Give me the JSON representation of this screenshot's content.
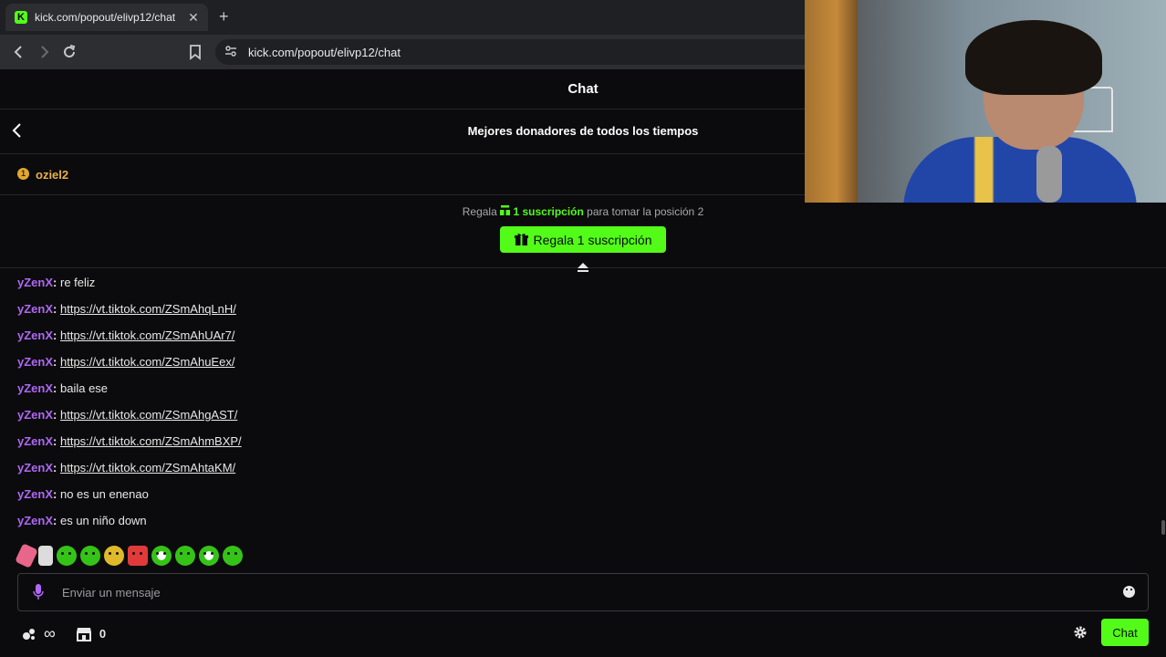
{
  "browser": {
    "tab_title": "kick.com/popout/elivp12/chat",
    "favicon_letter": "K",
    "tab_close": "✕",
    "new_tab": "+",
    "url": "kick.com/popout/elivp12/chat"
  },
  "chat": {
    "header_title": "Chat",
    "donors_title": "Mejores donadores de todos los tiempos",
    "top_donor": {
      "rank": "1",
      "name": "oziel2"
    },
    "gift_prompt": {
      "prefix": "Regala",
      "highlight": "1 suscripción",
      "suffix": "para tomar la posición 2"
    },
    "gift_button_label": "Regala 1 suscripción",
    "messages": [
      {
        "user": "yZenX",
        "text": "re feliz",
        "is_link": false
      },
      {
        "user": "yZenX",
        "text": "https://vt.tiktok.com/ZSmAhqLnH/",
        "is_link": true
      },
      {
        "user": "yZenX",
        "text": "https://vt.tiktok.com/ZSmAhUAr7/",
        "is_link": true
      },
      {
        "user": "yZenX",
        "text": "https://vt.tiktok.com/ZSmAhuEex/",
        "is_link": true
      },
      {
        "user": "yZenX",
        "text": "baila ese",
        "is_link": false
      },
      {
        "user": "yZenX",
        "text": "https://vt.tiktok.com/ZSmAhgAST/",
        "is_link": true
      },
      {
        "user": "yZenX",
        "text": "https://vt.tiktok.com/ZSmAhmBXP/",
        "is_link": true
      },
      {
        "user": "yZenX",
        "text": "https://vt.tiktok.com/ZSmAhtaKM/",
        "is_link": true
      },
      {
        "user": "yZenX",
        "text": "no es un enenao",
        "is_link": false
      },
      {
        "user": "yZenX",
        "text": "es un niño down",
        "is_link": false
      }
    ],
    "message_separator": ":",
    "emotes": [
      "pink-emote",
      "white-emote",
      "green-emote",
      "green-emote",
      "halo-emote",
      "red-emote",
      "panda-emote",
      "green-emote",
      "panda-emote",
      "green-emote"
    ],
    "input_placeholder": "Enviar un mensaje",
    "points_value": "∞",
    "store_count": "0",
    "send_button_label": "Chat"
  },
  "colors": {
    "accent": "#53fc18",
    "username": "#b067f5",
    "donor_gold": "#e8b04c",
    "background": "#0b0b0d"
  }
}
